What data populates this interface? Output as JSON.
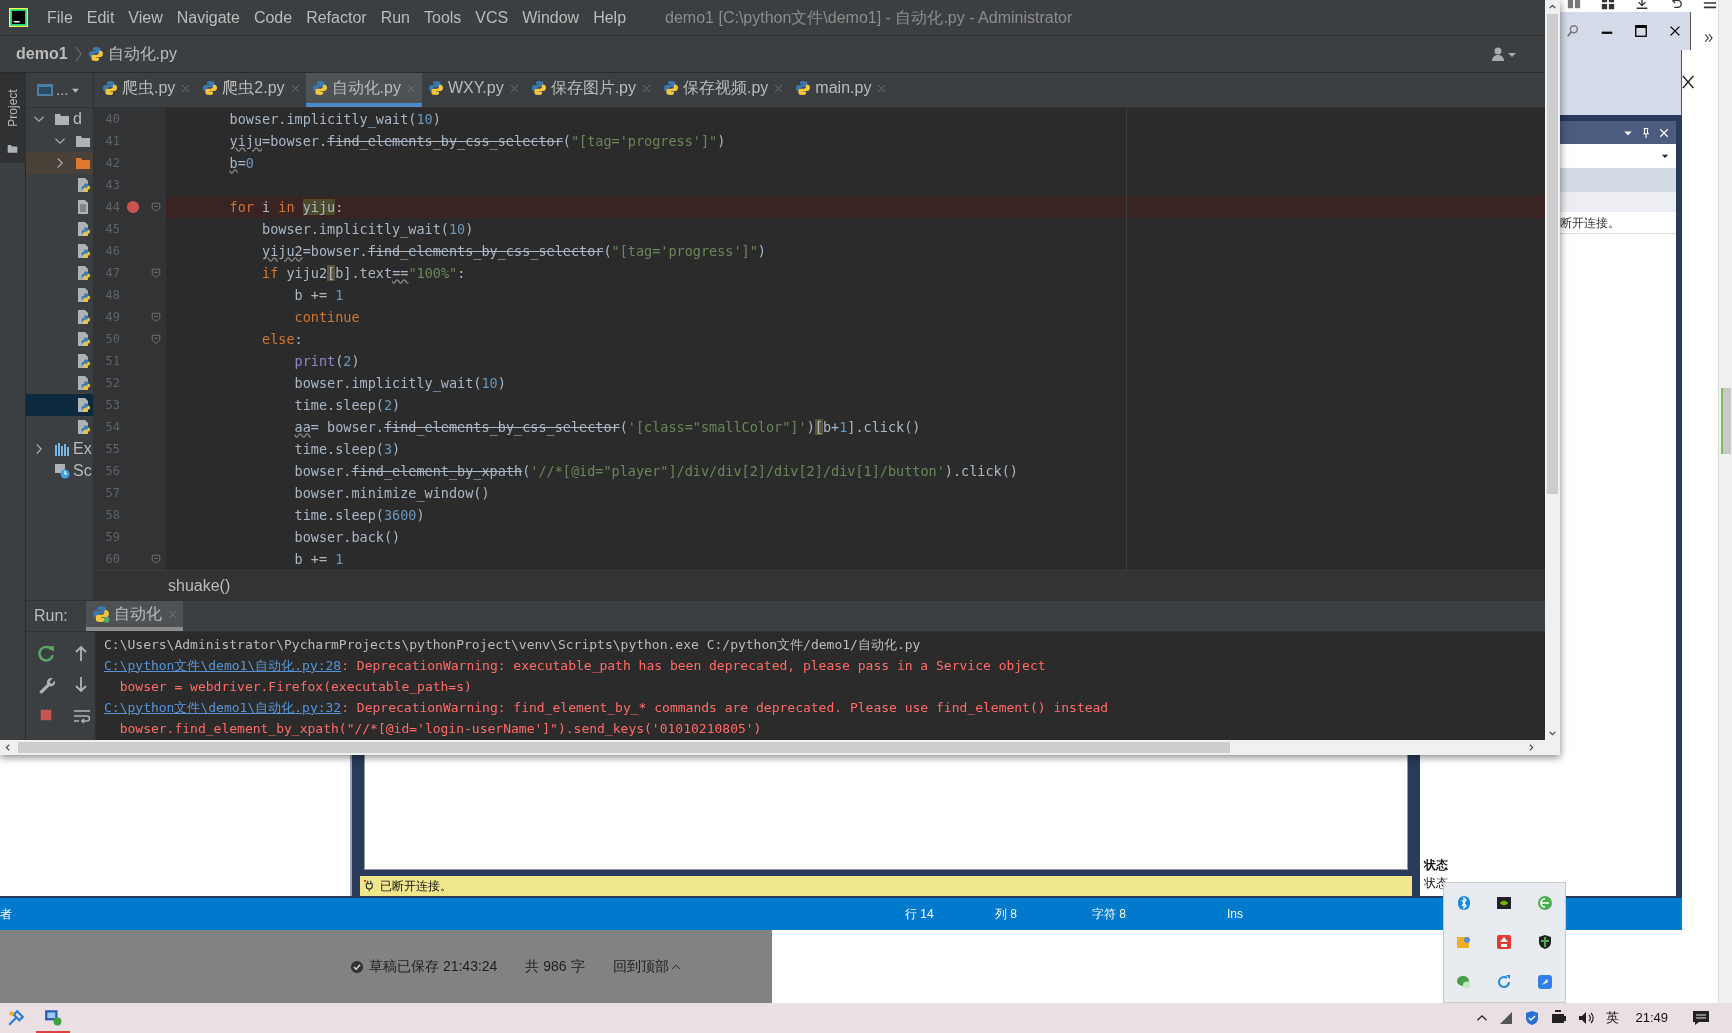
{
  "pycharm": {
    "menu": [
      "File",
      "Edit",
      "View",
      "Navigate",
      "Code",
      "Refactor",
      "Run",
      "Tools",
      "VCS",
      "Window",
      "Help"
    ],
    "title": "demo1 [C:\\python文件\\demo1] - 自动化.py - Administrator",
    "breadcrumb": [
      "demo1",
      "自动化.py"
    ],
    "side_tab": "Project",
    "tree_header": "...",
    "tabs": [
      {
        "label": "爬虫.py",
        "selected": false
      },
      {
        "label": "爬虫2.py",
        "selected": false
      },
      {
        "label": "自动化.py",
        "selected": true
      },
      {
        "label": "WXY.py",
        "selected": false
      },
      {
        "label": "保存图片.py",
        "selected": false
      },
      {
        "label": "保存视频.py",
        "selected": false
      },
      {
        "label": "main.py",
        "selected": false
      }
    ],
    "tree": [
      {
        "kind": "folder",
        "label": "d",
        "expanded": true,
        "selected": false,
        "children": [
          {
            "kind": "folder",
            "expanded": true,
            "selected": false
          },
          {
            "kind": "excluded-folder",
            "expanded": false,
            "selected": false,
            "highlighted": true
          },
          {
            "kind": "python-file",
            "selected": false
          },
          {
            "kind": "text-file",
            "selected": false
          },
          {
            "kind": "python-file",
            "selected": false
          },
          {
            "kind": "python-file",
            "selected": false
          },
          {
            "kind": "python-file",
            "selected": false
          },
          {
            "kind": "python-file",
            "selected": false
          },
          {
            "kind": "python-file",
            "selected": false
          },
          {
            "kind": "python-file",
            "selected": false
          },
          {
            "kind": "python-file",
            "selected": false
          },
          {
            "kind": "python-file",
            "selected": false
          },
          {
            "kind": "python-file",
            "selected": true
          },
          {
            "kind": "python-file",
            "selected": false
          }
        ]
      },
      {
        "kind": "libraries",
        "label": "Ex",
        "expanded": false,
        "selected": false
      },
      {
        "kind": "scratches",
        "label": "Sc",
        "selected": false
      }
    ],
    "code_lines": [
      {
        "number": "40",
        "segments": [
          {
            "text": "    bowser.implicitly_wait(",
            "kind": "plain"
          },
          {
            "text": "10",
            "kind": "num"
          },
          {
            "text": ")",
            "kind": "plain"
          }
        ]
      },
      {
        "number": "41",
        "segments": [
          {
            "text": "    yiju",
            "kind": "warn"
          },
          {
            "text": "=bowser.",
            "kind": "plain"
          },
          {
            "text": "find_elements_by_css_selector",
            "kind": "strike"
          },
          {
            "text": "(",
            "kind": "plain"
          },
          {
            "text": "\"[tag='progress']\"",
            "kind": "str"
          },
          {
            "text": ")",
            "kind": "plain"
          }
        ]
      },
      {
        "number": "42",
        "segments": [
          {
            "text": "    b",
            "kind": "warn"
          },
          {
            "text": "=",
            "kind": "plain"
          },
          {
            "text": "0",
            "kind": "num"
          }
        ]
      },
      {
        "number": "43"
      },
      {
        "number": "44",
        "breakpoint": true,
        "fold": true,
        "segments": [
          {
            "text": "    for",
            "kind": "kw"
          },
          {
            "text": " i ",
            "kind": "plain"
          },
          {
            "text": "in",
            "kind": "kw"
          },
          {
            "text": " yiju",
            "kind": "hl"
          },
          {
            "text": ":",
            "kind": "plain"
          }
        ]
      },
      {
        "number": "45",
        "segments": [
          {
            "text": "        bowser.implicitly_wait(",
            "kind": "plain"
          },
          {
            "text": "10",
            "kind": "num"
          },
          {
            "text": ")",
            "kind": "plain"
          }
        ]
      },
      {
        "number": "46",
        "segments": [
          {
            "text": "        yiju2",
            "kind": "warn"
          },
          {
            "text": "=bowser.",
            "kind": "plain"
          },
          {
            "text": "find_elements_by_css_selector",
            "kind": "strike"
          },
          {
            "text": "(",
            "kind": "plain"
          },
          {
            "text": "\"[tag='progress']\"",
            "kind": "str"
          },
          {
            "text": ")",
            "kind": "plain"
          }
        ]
      },
      {
        "number": "47",
        "fold": true,
        "segments": [
          {
            "text": "        if",
            "kind": "kw"
          },
          {
            "text": " yiju2",
            "kind": "plain"
          },
          {
            "text": "[",
            "kind": "match"
          },
          {
            "text": "b].text",
            "kind": "plain"
          },
          {
            "text": "==",
            "kind": "warn"
          },
          {
            "text": "\"100%\"",
            "kind": "str"
          },
          {
            "text": ":",
            "kind": "plain"
          }
        ]
      },
      {
        "number": "48",
        "segments": [
          {
            "text": "            b += ",
            "kind": "plain"
          },
          {
            "text": "1",
            "kind": "num"
          }
        ]
      },
      {
        "number": "49",
        "fold": true,
        "segments": [
          {
            "text": "            continue",
            "kind": "kw"
          }
        ]
      },
      {
        "number": "50",
        "fold": true,
        "segments": [
          {
            "text": "        else",
            "kind": "kw"
          },
          {
            "text": ":",
            "kind": "plain"
          }
        ]
      },
      {
        "number": "51",
        "segments": [
          {
            "text": "            print",
            "kind": "builtin"
          },
          {
            "text": "(",
            "kind": "plain"
          },
          {
            "text": "2",
            "kind": "num"
          },
          {
            "text": ")",
            "kind": "plain"
          }
        ]
      },
      {
        "number": "52",
        "segments": [
          {
            "text": "            bowser.implicitly_wait(",
            "kind": "plain"
          },
          {
            "text": "10",
            "kind": "num"
          },
          {
            "text": ")",
            "kind": "plain"
          }
        ]
      },
      {
        "number": "53",
        "segments": [
          {
            "text": "            time.sleep(",
            "kind": "plain"
          },
          {
            "text": "2",
            "kind": "num"
          },
          {
            "text": ")",
            "kind": "plain"
          }
        ]
      },
      {
        "number": "54",
        "segments": [
          {
            "text": "            aa",
            "kind": "warn"
          },
          {
            "text": "= bowser.",
            "kind": "plain"
          },
          {
            "text": "find_elements_by_css_selector",
            "kind": "strike"
          },
          {
            "text": "(",
            "kind": "plain"
          },
          {
            "text": "'[class=\"smallColor\"]'",
            "kind": "str"
          },
          {
            "text": ")",
            "kind": "plain"
          },
          {
            "text": "[",
            "kind": "match"
          },
          {
            "text": "b+",
            "kind": "plain"
          },
          {
            "text": "1",
            "kind": "num"
          },
          {
            "text": "].click()",
            "kind": "plain"
          }
        ]
      },
      {
        "number": "55",
        "segments": [
          {
            "text": "            time.sleep(",
            "kind": "plain"
          },
          {
            "text": "3",
            "kind": "num"
          },
          {
            "text": ")",
            "kind": "plain"
          }
        ]
      },
      {
        "number": "56",
        "segments": [
          {
            "text": "            bowser.",
            "kind": "plain"
          },
          {
            "text": "find_element_by_xpath",
            "kind": "strike"
          },
          {
            "text": "(",
            "kind": "plain"
          },
          {
            "text": "'//*[@id=\"player\"]/div/div[2]/div[2]/div[1]/button'",
            "kind": "str"
          },
          {
            "text": ").click()",
            "kind": "plain"
          }
        ]
      },
      {
        "number": "57",
        "segments": [
          {
            "text": "            bowser.minimize_window()",
            "kind": "plain"
          }
        ]
      },
      {
        "number": "58",
        "segments": [
          {
            "text": "            time.sleep(",
            "kind": "plain"
          },
          {
            "text": "3600",
            "kind": "num"
          },
          {
            "text": ")",
            "kind": "plain"
          }
        ]
      },
      {
        "number": "59",
        "segments": [
          {
            "text": "            bowser.back()",
            "kind": "plain"
          }
        ]
      },
      {
        "number": "60",
        "fold": true,
        "segments": [
          {
            "text": "            b += ",
            "kind": "plain"
          },
          {
            "text": "1",
            "kind": "num"
          }
        ]
      }
    ],
    "code_breadcrumb": "shuake()",
    "run": {
      "label": "Run:",
      "tab": "自动化",
      "console": [
        {
          "segments": [
            {
              "text": "C:\\Users\\Administrator\\PycharmProjects\\pythonProject\\venv\\Scripts\\python.exe C:/python文件/demo1/自动化.py",
              "kind": "plain"
            }
          ]
        },
        {
          "segments": [
            {
              "text": "C:\\python文件\\demo1\\自动化.py:28",
              "kind": "link"
            },
            {
              "text": ": DeprecationWarning: executable_path has been deprecated, please pass in a Service object",
              "kind": "error"
            }
          ]
        },
        {
          "segments": [
            {
              "text": "  bowser = webdriver.Firefox(executable_path=s)",
              "kind": "error"
            }
          ]
        },
        {
          "segments": [
            {
              "text": "C:\\python文件\\demo1\\自动化.py:32",
              "kind": "link"
            },
            {
              "text": ": DeprecationWarning: find_element_by_* commands are deprecated. Please use find_element() instead",
              "kind": "error"
            }
          ]
        },
        {
          "segments": [
            {
              "text": "  bowser.find_element_by_xpath(\"//*[@id='login-userName']\").send_keys('01010210805')",
              "kind": "error"
            }
          ]
        }
      ]
    }
  },
  "back_window": {
    "pane_text": "断开连接。",
    "connection_status": "已断开连接。",
    "status_heading": "状态",
    "status_value": "状态",
    "status_bar": {
      "left": "者",
      "items": [
        "行 14",
        "列 8",
        "字符 8",
        "Ins"
      ]
    }
  },
  "page": {
    "saved": "草稿已保存 21:43:24",
    "word_count": "共 986 字",
    "back_to_top": "回到顶部"
  },
  "taskbar": {
    "ime": "英",
    "clock": "21:49"
  }
}
